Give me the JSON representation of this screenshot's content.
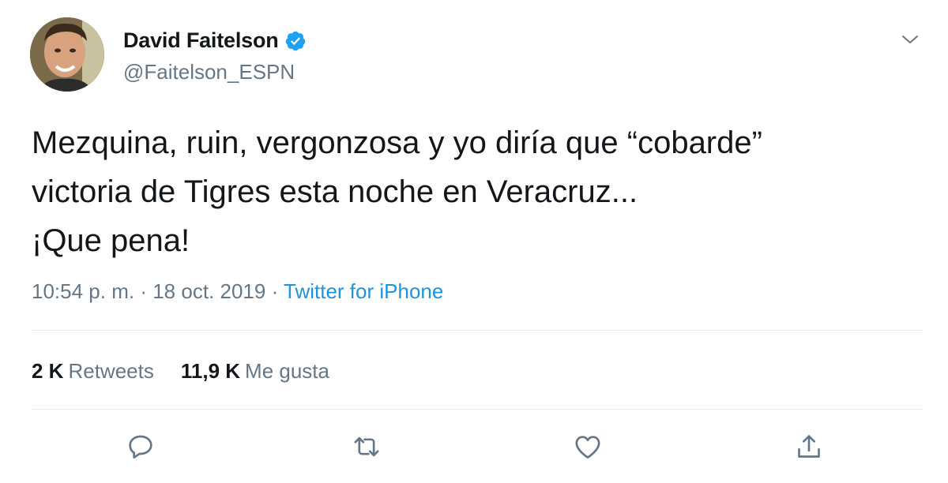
{
  "user": {
    "display_name": "David Faitelson",
    "handle": "@Faitelson_ESPN",
    "verified_icon": "verified-badge-icon"
  },
  "tweet": {
    "lines": [
      "Mezquina, ruin, vergonzosa y yo diría que “cobarde”",
      "victoria de Tigres esta noche en Veracruz...",
      "¡Que pena!"
    ],
    "time": "10:54 p. m.",
    "date": "18 oct. 2019",
    "separator": "·",
    "source": "Twitter for iPhone"
  },
  "stats": {
    "retweets_count": "2 K",
    "retweets_label": "Retweets",
    "likes_count": "11,9 K",
    "likes_label": "Me gusta"
  },
  "actions": [
    "reply-icon",
    "retweet-icon",
    "like-icon",
    "share-icon"
  ],
  "colors": {
    "text": "#14171a",
    "secondary": "#657786",
    "link": "#1b95e0",
    "verified": "#1da1f2",
    "divider": "#e6ecf0"
  }
}
